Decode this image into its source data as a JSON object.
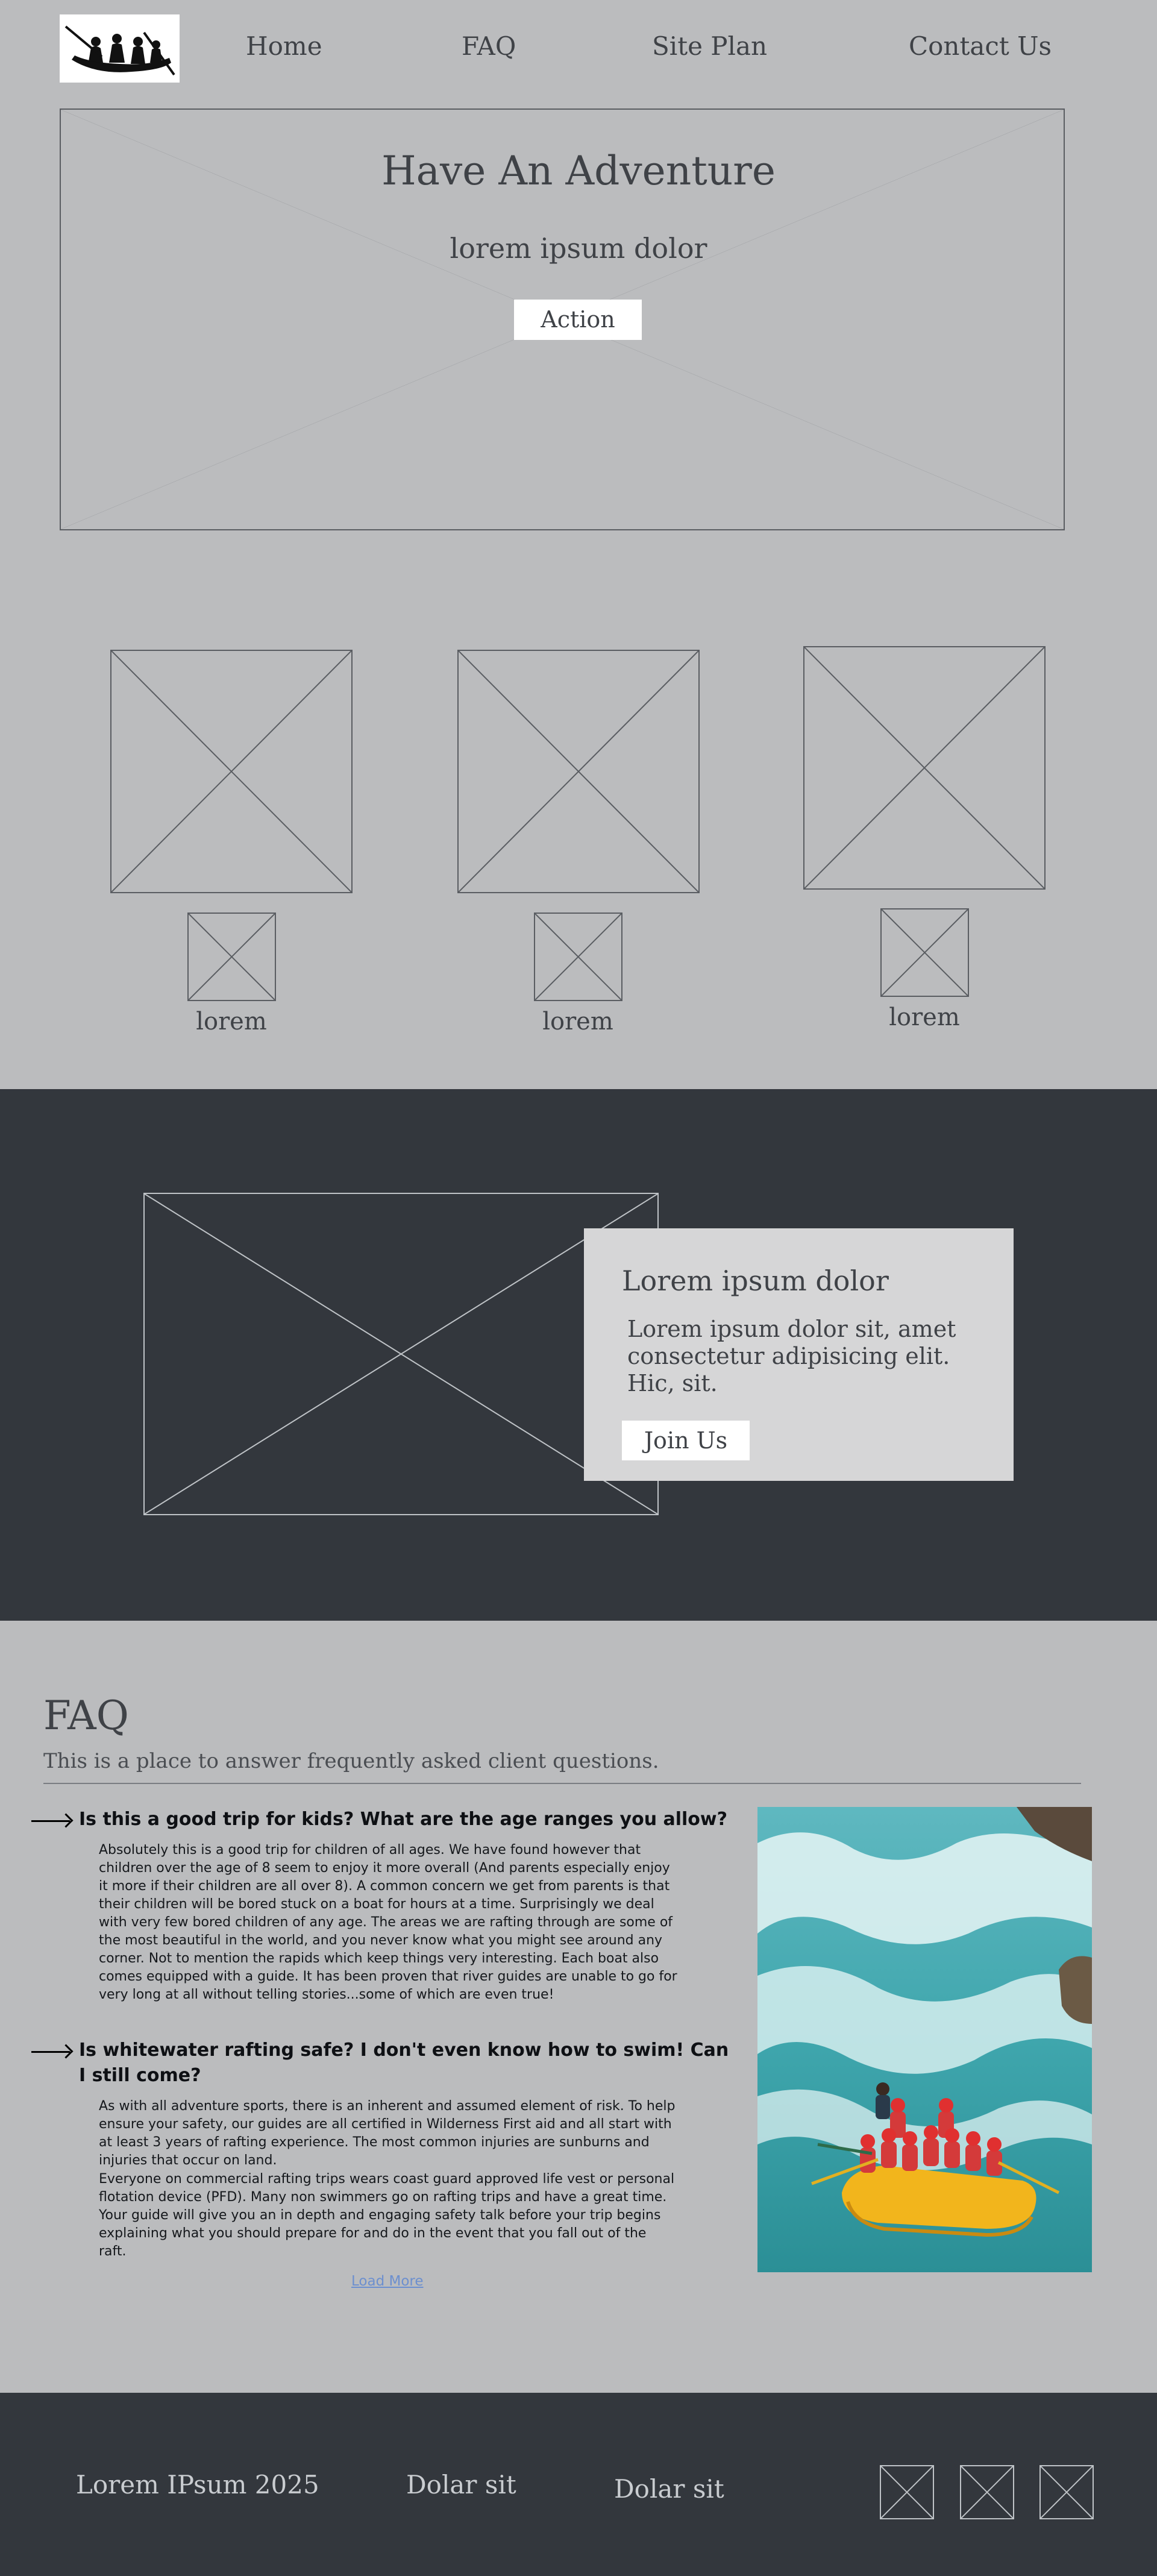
{
  "nav": {
    "logo_alt": "rafting logo",
    "items": [
      "Home",
      "FAQ",
      "Site Plan",
      "Contact Us"
    ]
  },
  "hero": {
    "title": "Have An Adventure",
    "subtitle": "lorem ipsum dolor",
    "action_label": "Action"
  },
  "cards": [
    {
      "label": "lorem"
    },
    {
      "label": "lorem"
    },
    {
      "label": "lorem"
    }
  ],
  "feature": {
    "title": "Lorem ipsum dolor",
    "body": "Lorem ipsum dolor sit, amet consectetur adipisicing elit. Hic, sit.",
    "button_label": "Join Us"
  },
  "faq": {
    "title": "FAQ",
    "subtitle": "This is a place to answer frequently asked client questions.",
    "questions": [
      {
        "question": "Is this a good trip for kids? What are the age ranges you allow?",
        "answer": "Absolutely this is a good trip for children of all ages. We have found however that children over the age of 8 seem to enjoy it more overall (And parents especially enjoy it more if their children are all over 8). A common concern we get from parents is that their children will be bored stuck on a boat for hours at a time. Surprisingly we deal with very few bored children of any age. The areas we are rafting through are some of the most beautiful in the world, and you never know what you might see around any corner. Not to mention the rapids which keep things very interesting. Each boat also comes equipped with a guide. It has been proven that river guides are unable to go for very long at all without telling stories...some of which are even true!"
      },
      {
        "question": "Is whitewater rafting safe? I don't even know how to swim! Can I still come?",
        "answer_p1": "As with all adventure sports, there is an inherent and assumed element of risk. To help ensure your safety, our guides are all certified in Wilderness First aid and all start with at least 3 years of rafting experience. The most common injuries are sunburns and injuries that occur on land.",
        "answer_p2": "Everyone on commercial rafting trips wears coast guard approved life vest or personal flotation device (PFD). Many non swimmers go on rafting trips and have a great time. Your guide will give you an in depth and engaging safety talk before your trip begins explaining what you should prepare for and do in the event that you fall out of the raft."
      }
    ],
    "load_more": "Load More"
  },
  "footer": {
    "copyright": "Lorem IPsum 2025",
    "link1": "Dolar sit",
    "link2": "Dolar sit"
  },
  "colors": {
    "page_bg": "#bbbcbe",
    "dark_bg": "#33373d",
    "panel_bg": "#d6d6d7",
    "link": "#6c8fcf"
  }
}
